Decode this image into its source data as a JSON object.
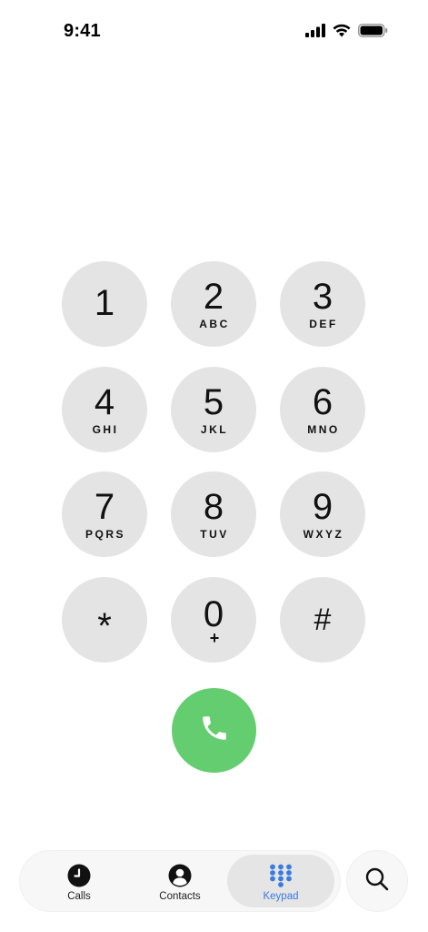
{
  "status_bar": {
    "time": "9:41"
  },
  "keypad": {
    "keys": [
      {
        "digit": "1",
        "letters": ""
      },
      {
        "digit": "2",
        "letters": "ABC"
      },
      {
        "digit": "3",
        "letters": "DEF"
      },
      {
        "digit": "4",
        "letters": "GHI"
      },
      {
        "digit": "5",
        "letters": "JKL"
      },
      {
        "digit": "6",
        "letters": "MNO"
      },
      {
        "digit": "7",
        "letters": "PQRS"
      },
      {
        "digit": "8",
        "letters": "TUV"
      },
      {
        "digit": "9",
        "letters": "WXYZ"
      },
      {
        "digit": "*",
        "letters": ""
      },
      {
        "digit": "0",
        "letters": "+"
      },
      {
        "digit": "#",
        "letters": ""
      }
    ]
  },
  "call_button": {
    "icon": "phone-icon",
    "color": "#64cd6f"
  },
  "tab_bar": {
    "tabs": [
      {
        "label": "Calls",
        "icon": "clock-icon"
      },
      {
        "label": "Contacts",
        "icon": "person-circle-icon"
      },
      {
        "label": "Keypad",
        "icon": "keypad-grid-icon",
        "active": true
      }
    ],
    "active_color": "#3a7be0"
  },
  "search": {
    "icon": "search-icon"
  }
}
